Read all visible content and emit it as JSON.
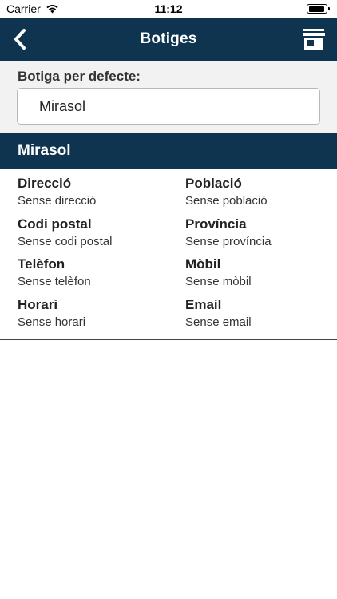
{
  "status_bar": {
    "carrier": "Carrier",
    "time": "11:12"
  },
  "nav": {
    "title": "Botiges",
    "back_icon": "chevron-left-icon",
    "store_icon": "store-icon",
    "bar_color": "#0f3450"
  },
  "default_store": {
    "label": "Botiga per defecte:",
    "value": "Mirasol"
  },
  "store": {
    "name": "Mirasol",
    "fields": [
      {
        "label": "Direcció",
        "value": "Sense direcció"
      },
      {
        "label": "Població",
        "value": "Sense població"
      },
      {
        "label": "Codi postal",
        "value": "Sense codi postal"
      },
      {
        "label": "Província",
        "value": "Sense província"
      },
      {
        "label": "Telèfon",
        "value": "Sense telèfon"
      },
      {
        "label": "Mòbil",
        "value": "Sense mòbil"
      },
      {
        "label": "Horari",
        "value": "Sense horari"
      },
      {
        "label": "Email",
        "value": "Sense email"
      }
    ]
  }
}
